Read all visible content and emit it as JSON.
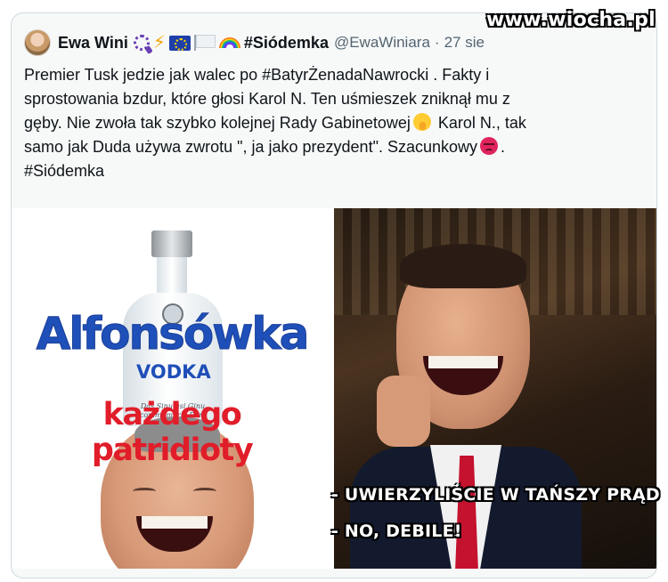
{
  "tweet": {
    "author": {
      "display_name": "Ewa Wini",
      "name_emojis": [
        "prayer-beads-icon",
        "lightning-icon",
        "eu-flag-icon",
        "white-flag-icon",
        "rainbow-icon"
      ],
      "hashtag_in_name": "#Siódemka",
      "handle": "@EwaWiniara",
      "separator": "·",
      "date": "27 sie"
    },
    "text_lines": [
      "Premier Tusk jedzie jak walec po #BatyrŻenadaNawrocki . Fakty i",
      "sprostowania bzdur, które głosi Karol N. Ten uśmieszek zniknął mu z",
      "gęby. Nie zwoła tak szybko kolejnej  Rady Gabinetowej",
      " Karol N., tak",
      "samo jak Duda używa zwrotu \", ja jako prezydent\". Szacunkowy",
      ".",
      "#Siódemka"
    ],
    "text_emojis": [
      "shushing-face-icon",
      "angry-face-icon"
    ]
  },
  "media": {
    "left_image": {
      "brand": "Alfonsówka",
      "product": "VODKA",
      "slogan": "każdego patridioty",
      "bottle_script": "Das Sinufasi Ginu commumerly Dem slunsle! dambin"
    },
    "right_image": {
      "caption_line_1": "- UWIERZYLIŚCIE W TAŃSZY PRĄD",
      "caption_line_2": "- NO, DEBILE!"
    }
  },
  "watermark": "www.wiocha.pl",
  "colors": {
    "card_background": "#f7f9f9",
    "border": "#cfd9de",
    "secondary_text": "#536471",
    "brand_blue": "#1f4fb8",
    "slogan_red": "#e11d2a"
  }
}
